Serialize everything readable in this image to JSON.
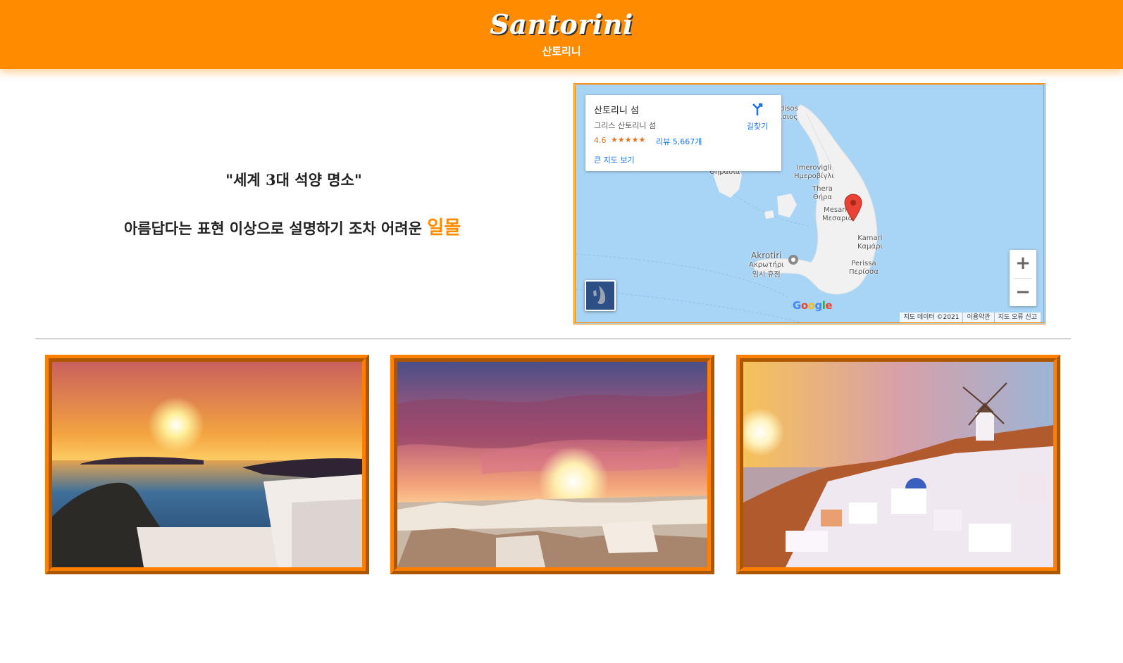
{
  "header": {
    "title": "Santorini",
    "subtitle": "산토리니"
  },
  "intro": {
    "quote": "\"세계 3대 석양 명소\"",
    "line_prefix": "아름답다는 표현 이상으로 설명하기 조차 어려운",
    "line_highlight": "일몰"
  },
  "map": {
    "info_card": {
      "title": "산토리니 섬",
      "address": "그리스 산토리니 섬",
      "rating": "4.6",
      "stars": "★★★★★",
      "reviews": "리뷰 5,667개",
      "directions_label": "길찾기",
      "larger_map_link": "큰 지도 보기"
    },
    "places": [
      "Θηρασία",
      "Imerovigli",
      "Ημεροβίγλι",
      "Thera",
      "Θήρα",
      "Mesaria",
      "Μεσαριά",
      "Kamari",
      "Καμάρι",
      "Perissa",
      "Περίσσα",
      "Akrotiri",
      "Ακρωτήρι",
      "임시 휴점",
      "disos",
      "ισιος"
    ],
    "zoom_in": "+",
    "zoom_out": "−",
    "google_logo": "Google",
    "attribution": [
      "지도 데이터 ©2021",
      "이용약관",
      "지도 오류 신고"
    ],
    "colors": {
      "water": "#a8d4f5",
      "land": "#f1f1f1",
      "pin": "#ea4335"
    }
  },
  "gallery": {
    "images": [
      "sunset-over-skaros-rock",
      "oia-sunset-sky",
      "oia-windmill-sunset"
    ]
  },
  "colors": {
    "accent": "#ff8c00",
    "frame": "#ff8000"
  }
}
